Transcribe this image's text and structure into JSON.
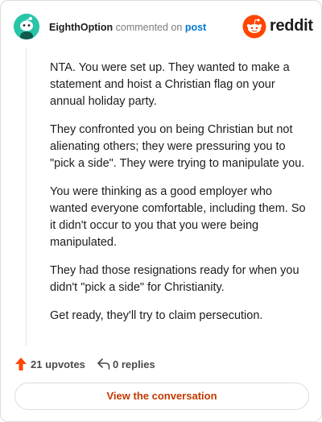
{
  "header": {
    "author": "EighthOption",
    "verb": "commented on",
    "target": "post",
    "logo_text": "reddit"
  },
  "comment": {
    "paragraphs": [
      "NTA. You were set up. They wanted to make a statement and hoist a Christian flag on your annual holiday party.",
      "They confronted you on being Christian but not alienating others; they were pressuring you to \"pick a side\". They were trying to manipulate you.",
      "You were thinking as a good employer who wanted everyone comfortable, including them. So it didn't occur to you that you were being manipulated.",
      "They had those resignations ready for when you didn't \"pick a side\" for Christianity.",
      "Get ready, they'll try to claim persecution."
    ]
  },
  "actions": {
    "upvotes": "21 upvotes",
    "replies": "0 replies"
  },
  "cta": {
    "label": "View the conversation"
  },
  "colors": {
    "avatar_bg": "#29c5a8",
    "reddit_orange": "#ff4500",
    "link_blue": "#0079d3",
    "cta_text": "#c23a00"
  }
}
